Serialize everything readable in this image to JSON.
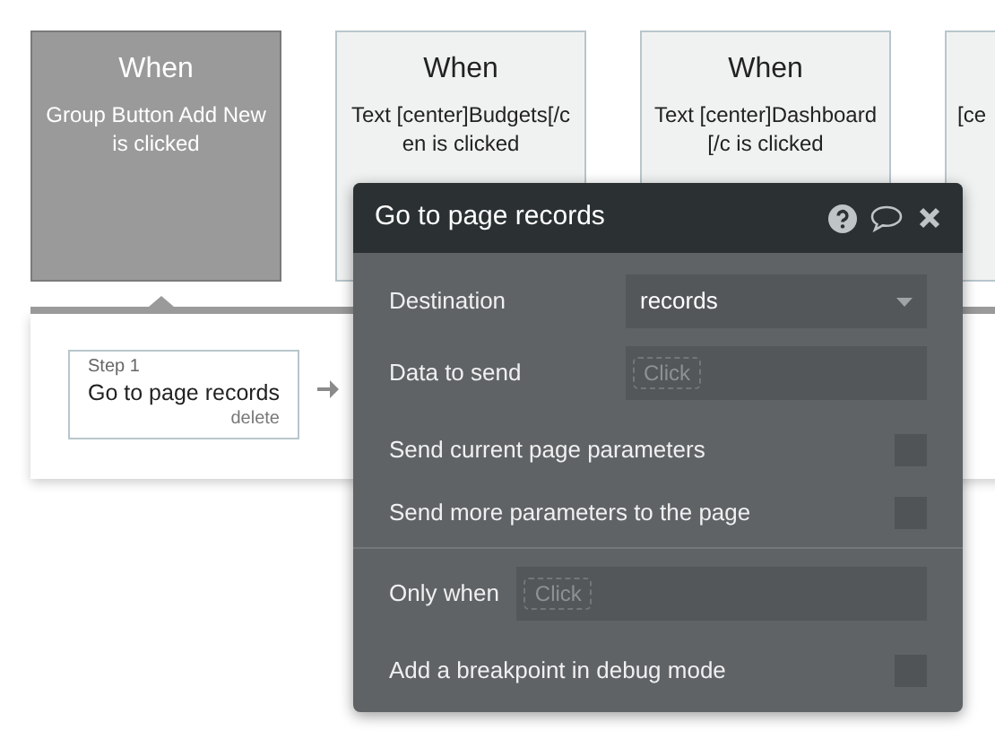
{
  "events": [
    {
      "title": "When",
      "text": "Group Button Add New is clicked",
      "selected": true
    },
    {
      "title": "When",
      "text": "Text [center]Budgets[/cen is clicked",
      "selected": false
    },
    {
      "title": "When",
      "text": "Text [center]Dashboard[/c is clicked",
      "selected": false
    },
    {
      "text": "[ce",
      "selected": false
    }
  ],
  "workflow": {
    "steps": [
      {
        "label": "Step 1",
        "action": "Go to page records",
        "delete": "delete"
      }
    ]
  },
  "popup": {
    "title": "Go to page records",
    "rows": [
      {
        "kind": "dropdown",
        "label": "Destination",
        "value": "records"
      },
      {
        "kind": "field",
        "label": "Data to send",
        "placeholder": "Click"
      },
      {
        "kind": "checkbox",
        "label": "Send current page parameters",
        "checked": false
      },
      {
        "kind": "checkbox",
        "label": "Send more parameters to the page",
        "checked": false
      },
      {
        "kind": "divider"
      },
      {
        "kind": "wide_field",
        "label": "Only when",
        "placeholder": "Click"
      },
      {
        "kind": "checkbox",
        "label": "Add a breakpoint in debug mode",
        "checked": false
      }
    ]
  }
}
